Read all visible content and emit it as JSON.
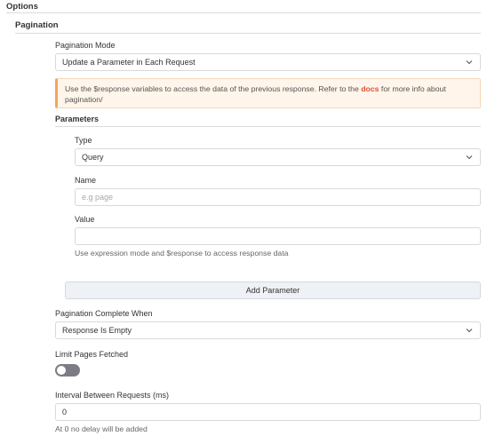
{
  "options": {
    "title": "Options"
  },
  "pagination": {
    "title": "Pagination",
    "mode_label": "Pagination Mode",
    "mode_value": "Update a Parameter in Each Request",
    "notice": {
      "text_before": "Use the $response variables to access the data of the previous response. Refer to the ",
      "link_text": "docs",
      "text_after": " for more info about pagination/"
    },
    "parameters": {
      "title": "Parameters",
      "type_label": "Type",
      "type_value": "Query",
      "name_label": "Name",
      "name_placeholder": "e.g page",
      "value_label": "Value",
      "value_value": "",
      "value_hint": "Use expression mode and $response to access response data",
      "add_button": "Add Parameter"
    },
    "complete_label": "Pagination Complete When",
    "complete_value": "Response Is Empty",
    "limit_label": "Limit Pages Fetched",
    "limit_enabled": false,
    "interval_label": "Interval Between Requests (ms)",
    "interval_value": "0",
    "interval_hint": "At 0 no delay will be added"
  },
  "icons": {
    "chevron": "chevron-down-icon"
  },
  "colors": {
    "accent_link": "#e04e39",
    "notice_border": "#f4a75a",
    "toggle_off": "#7c7c85"
  }
}
